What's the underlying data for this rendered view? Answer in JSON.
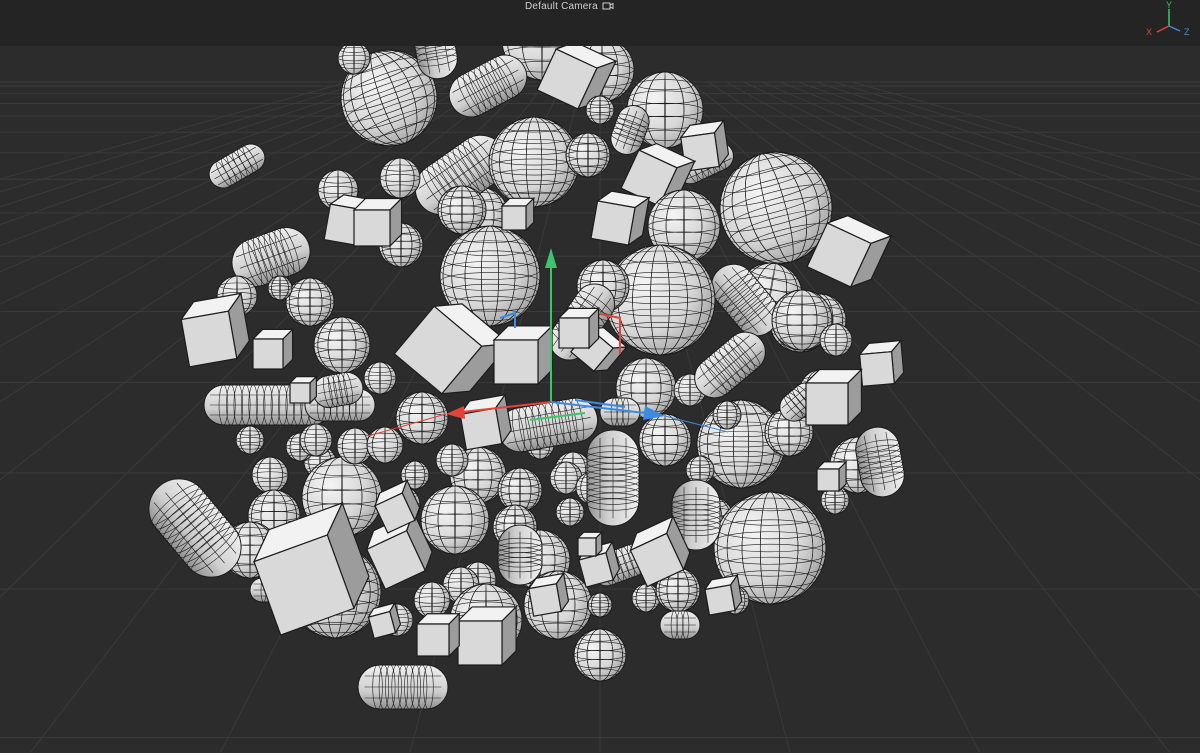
{
  "viewport": {
    "camera_name": "Default Camera",
    "camera_icon": "camera-switch-icon"
  },
  "axis_gizmo": {
    "x_label": "X",
    "y_label": "Y",
    "z_label": "Z",
    "x_color": "#e0443a",
    "y_color": "#3ec46d",
    "z_color": "#3d8ae0"
  },
  "manipulator": {
    "x_color": "#e0443a",
    "y_color": "#3ec46d",
    "z_color": "#3d8ae0"
  },
  "colors": {
    "background": "#2c2c2c",
    "topbar": "#242424",
    "grid_line": "#3a3a3a",
    "mesh_fill": "#e6e6e6",
    "wire": "#1c1c1c"
  }
}
